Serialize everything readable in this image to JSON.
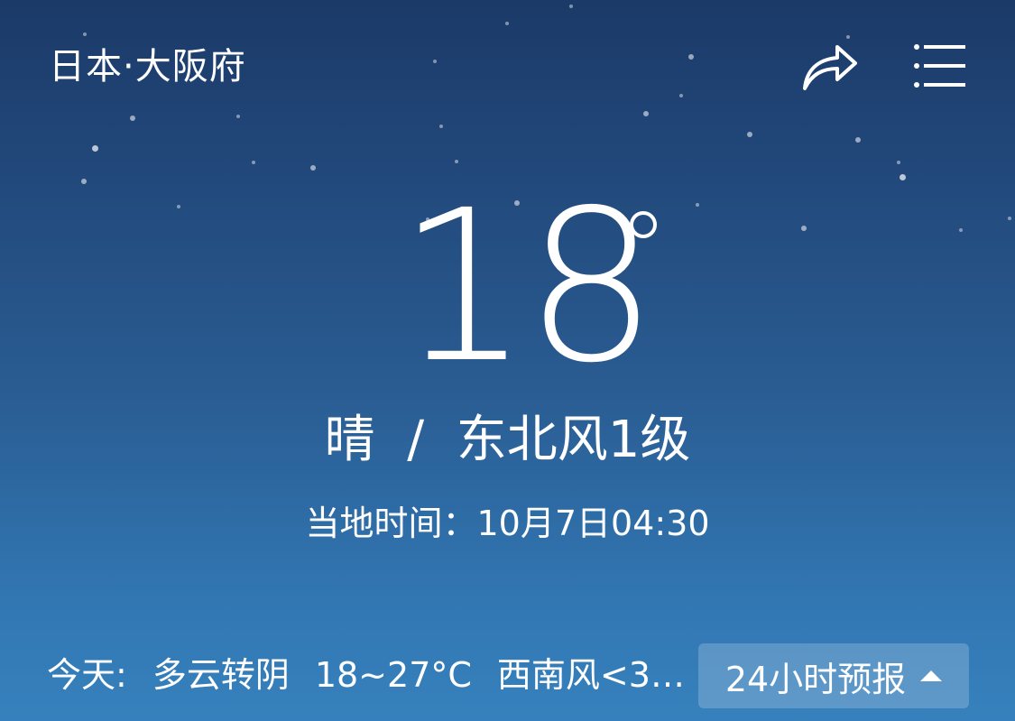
{
  "header": {
    "location": "日本·大阪府",
    "share_icon": "share-arrow-icon",
    "menu_icon": "list-menu-icon"
  },
  "current": {
    "temperature": "18",
    "condition_text": "晴  /  东北风1级",
    "local_time_text": "当地时间：10月7日04:30"
  },
  "today": {
    "label": "今天:",
    "weather": "多云转阴",
    "temp_range": "18~27°C",
    "wind": "西南风<3…"
  },
  "forecast_button": {
    "label": "24小时预报",
    "icon": "caret-up-icon"
  },
  "colors": {
    "background_top": "#1b3a68",
    "background_bottom": "#3681bd",
    "text": "#ffffff"
  }
}
